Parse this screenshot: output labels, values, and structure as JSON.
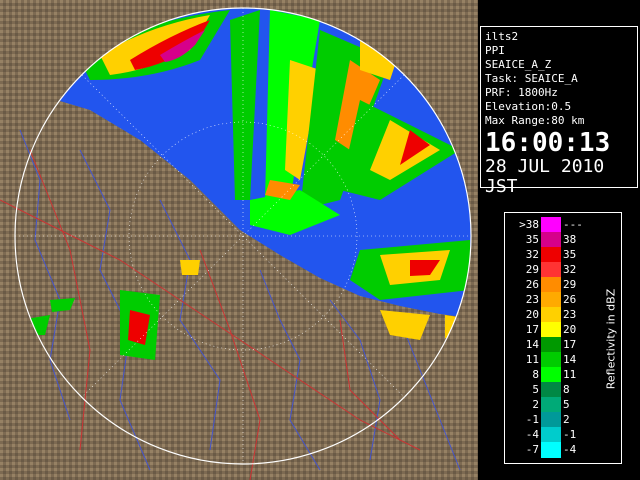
{
  "info": {
    "lines": [
      "ilts2",
      "PPI",
      "SEAICE_A_Z",
      "Task: SEAICE_A",
      "PRF: 1800Hz",
      "Elevation:0.5",
      "Max Range:80 km"
    ],
    "time": "16:00:13",
    "date": "28 JUL 2010 JST"
  },
  "legend": {
    "unit_label": "Reflectivity in dBZ",
    "rows": [
      {
        "lo": ">38",
        "hi": "---",
        "color": "#ff00ff"
      },
      {
        "lo": "35",
        "hi": "38",
        "color": "#d6008a"
      },
      {
        "lo": "32",
        "hi": "35",
        "color": "#ee0000"
      },
      {
        "lo": "29",
        "hi": "32",
        "color": "#ff3333"
      },
      {
        "lo": "26",
        "hi": "29",
        "color": "#ff8c00"
      },
      {
        "lo": "23",
        "hi": "26",
        "color": "#ffaa00"
      },
      {
        "lo": "20",
        "hi": "23",
        "color": "#ffd000"
      },
      {
        "lo": "17",
        "hi": "20",
        "color": "#ffff00"
      },
      {
        "lo": "14",
        "hi": "17",
        "color": "#009900"
      },
      {
        "lo": "11",
        "hi": "14",
        "color": "#00cc00"
      },
      {
        "lo": "8",
        "hi": "11",
        "color": "#00ff00"
      },
      {
        "lo": "5",
        "hi": "8",
        "color": "#008844"
      },
      {
        "lo": "2",
        "hi": "5",
        "color": "#00aa77"
      },
      {
        "lo": "-1",
        "hi": "2",
        "color": "#009999"
      },
      {
        "lo": "-4",
        "hi": "-1",
        "color": "#00cccc"
      },
      {
        "lo": "-7",
        "hi": "-4",
        "color": "#00ffff"
      }
    ]
  },
  "colors": {
    "sea": "#2255ee",
    "land": "#8a7458",
    "river": "#4455cc",
    "border": "#cc3333",
    "range_ring": "#ffffff"
  }
}
